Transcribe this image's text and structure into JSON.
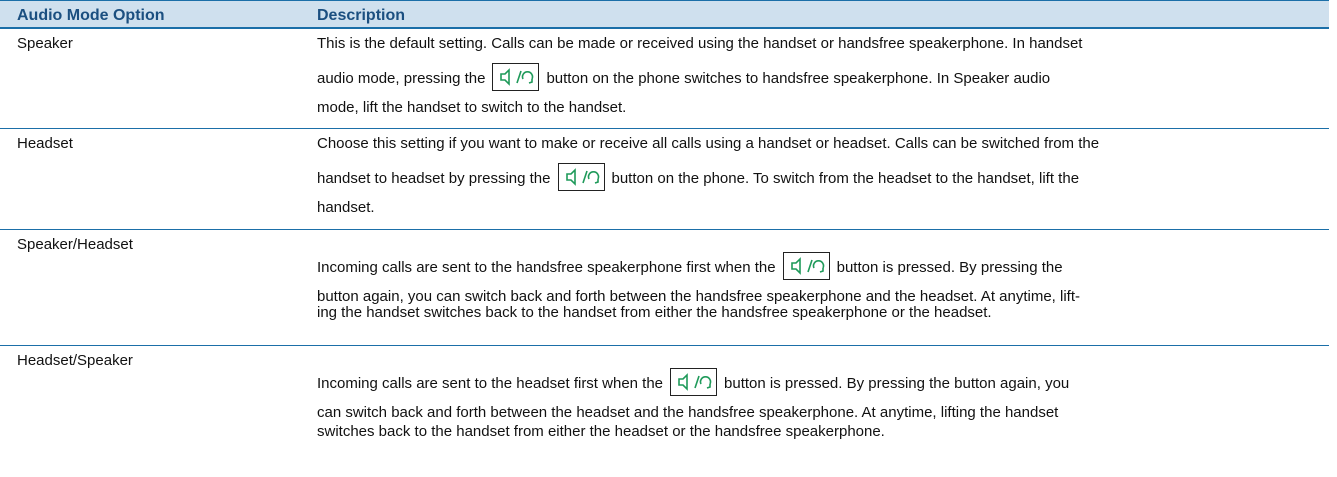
{
  "table": {
    "headers": {
      "option": "Audio Mode Option",
      "description": "Description"
    },
    "rows": [
      {
        "option": "Speaker",
        "lines": [
          "This is the default setting. Calls can be made or received using the handset or handsfree speakerphone. In handset",
          {
            "before": "audio mode, pressing the",
            "after": "button on the phone switches to handsfree speakerphone. In Speaker audio"
          },
          "mode, lift the handset to switch to the handset."
        ]
      },
      {
        "option": "Headset",
        "lines": [
          "Choose this setting if you want to make or receive all calls using a handset or headset. Calls can be switched from the",
          {
            "before": "handset to headset by pressing the",
            "after": "button on the phone. To switch from the headset to the handset, lift the"
          },
          "handset."
        ]
      },
      {
        "option": "Speaker/Headset",
        "lines": [
          {
            "before": "Incoming calls are sent to the handsfree speakerphone first when the",
            "after": "button is pressed. By pressing the"
          },
          "button again, you can switch back and forth between the handsfree speakerphone and the headset. At anytime, lift-",
          "ing the handset switches back to the handset from either the handsfree speakerphone or the headset."
        ]
      },
      {
        "option": "Headset/Speaker",
        "lines": [
          {
            "before": "Incoming calls are sent to the headset first when the",
            "after": "button is pressed. By pressing the button again, you"
          },
          "can switch back and forth between the headset and the handsfree speakerphone. At anytime, lifting the handset",
          "switches back to the handset from either the headset or the handsfree speakerphone."
        ]
      }
    ]
  },
  "icon": "speaker-headset-key-icon",
  "colors": {
    "header_bg": "#cfe0ee",
    "header_text": "#1b4f80",
    "rule": "#1b6fa8",
    "icon_green": "#1f9a5a"
  }
}
